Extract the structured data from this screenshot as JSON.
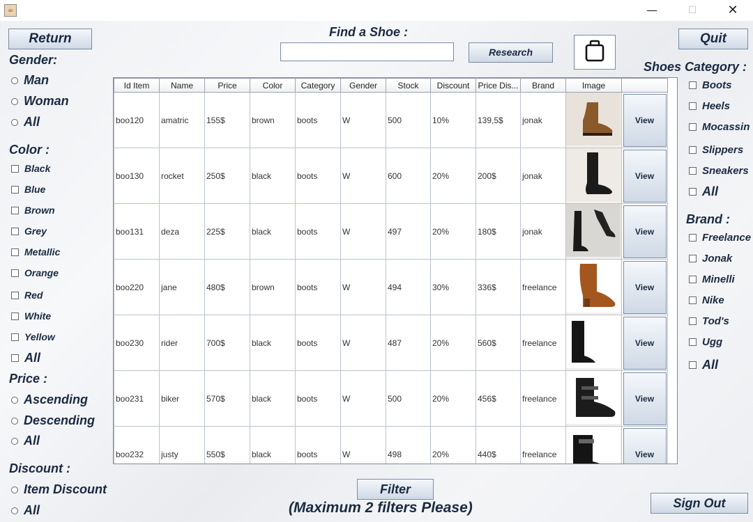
{
  "window": {
    "icon": "java-cup-icon",
    "minimize": "—",
    "maximize": "☐",
    "close": "✕"
  },
  "header": {
    "return_label": "Return",
    "find_title": "Find a Shoe :",
    "search_value": "",
    "research_label": "Research",
    "bag_icon": "shopping-bag-icon",
    "quit_label": "Quit"
  },
  "filters_left": {
    "gender_title": "Gender:",
    "gender_options": [
      "Man",
      "Woman",
      "All"
    ],
    "color_title": "Color :",
    "color_options": [
      "Black",
      "Blue",
      "Brown",
      "Grey",
      "Metallic",
      "Orange",
      "Red",
      "White",
      "Yellow",
      "All"
    ],
    "price_title": "Price :",
    "price_options": [
      "Ascending",
      "Descending",
      "All"
    ],
    "discount_title": "Discount :",
    "discount_options": [
      "Item Discount",
      "All"
    ]
  },
  "filters_right": {
    "category_title": "Shoes Category :",
    "category_options": [
      "Boots",
      "Heels",
      "Mocassin",
      "Slippers",
      "Sneakers",
      "All"
    ],
    "brand_title": "Brand :",
    "brand_options": [
      "Freelance",
      "Jonak",
      "Minelli",
      "Nike",
      "Tod's",
      "Ugg",
      "All"
    ]
  },
  "table": {
    "columns": [
      "Id Item",
      "Name",
      "Price",
      "Color",
      "Category",
      "Gender",
      "Stock",
      "Discount",
      "Price Dis...",
      "Brand",
      "Image",
      ""
    ],
    "view_label": "View",
    "rows": [
      {
        "id": "boo120",
        "name": "amatric",
        "price": "155$",
        "color": "brown",
        "category": "boots",
        "gender": "W",
        "stock": "500",
        "discount": "10%",
        "price_dis": "139,5$",
        "brand": "jonak"
      },
      {
        "id": "boo130",
        "name": "rocket",
        "price": "250$",
        "color": "black",
        "category": "boots",
        "gender": "W",
        "stock": "600",
        "discount": "20%",
        "price_dis": "200$",
        "brand": "jonak"
      },
      {
        "id": "boo131",
        "name": "deza",
        "price": "225$",
        "color": "black",
        "category": "boots",
        "gender": "W",
        "stock": "497",
        "discount": "20%",
        "price_dis": "180$",
        "brand": "jonak"
      },
      {
        "id": "boo220",
        "name": "jane",
        "price": "480$",
        "color": "brown",
        "category": "boots",
        "gender": "W",
        "stock": "494",
        "discount": "30%",
        "price_dis": "336$",
        "brand": "freelance"
      },
      {
        "id": "boo230",
        "name": "rider",
        "price": "700$",
        "color": "black",
        "category": "boots",
        "gender": "W",
        "stock": "487",
        "discount": "20%",
        "price_dis": "560$",
        "brand": "freelance"
      },
      {
        "id": "boo231",
        "name": "biker",
        "price": "570$",
        "color": "black",
        "category": "boots",
        "gender": "W",
        "stock": "500",
        "discount": "20%",
        "price_dis": "456$",
        "brand": "freelance"
      },
      {
        "id": "boo232",
        "name": "justy",
        "price": "550$",
        "color": "black",
        "category": "boots",
        "gender": "W",
        "stock": "498",
        "discount": "20%",
        "price_dis": "440$",
        "brand": "freelance"
      }
    ]
  },
  "footer": {
    "filter_label": "Filter",
    "note": "(Maximum 2 filters Please)",
    "signout_label": "Sign Out"
  }
}
